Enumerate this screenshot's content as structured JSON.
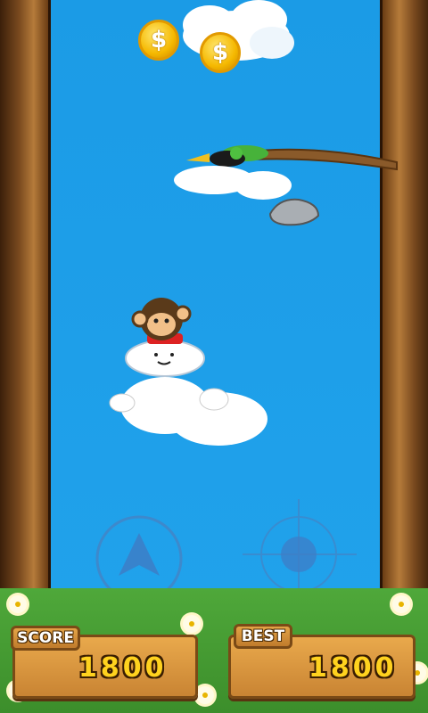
{
  "coins": [
    "$",
    "$"
  ],
  "hud": {
    "score_label": "SCORE",
    "score_value": "1800",
    "best_label": "BEST",
    "best_value": "1800"
  },
  "icons": {
    "jump": "up-arrow-icon",
    "shoot": "crosshair-icon"
  },
  "colors": {
    "sky": "#1f9ee8",
    "score_digits": "#ffd21e",
    "wood": "#c98433"
  }
}
